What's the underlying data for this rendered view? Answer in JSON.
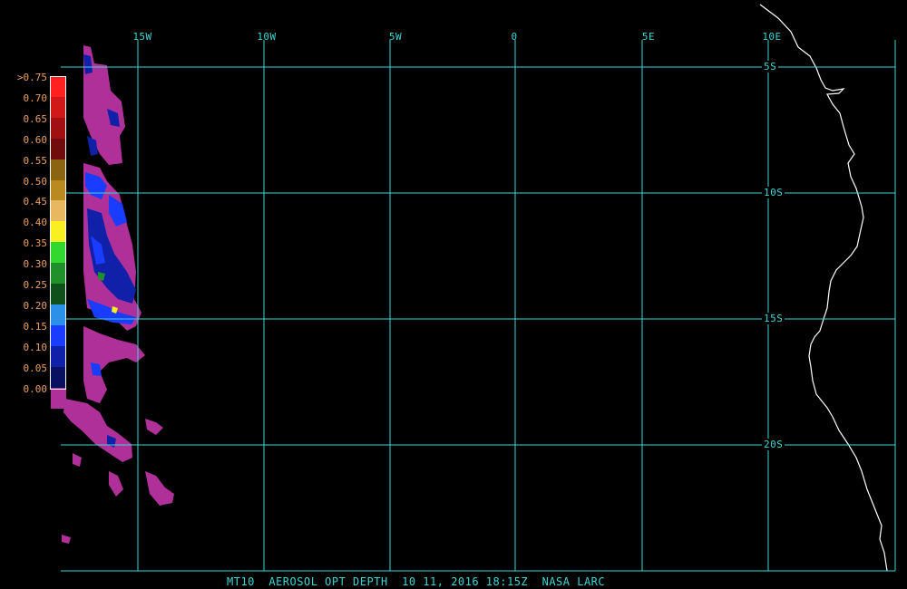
{
  "map": {
    "longitude_labels": [
      "15W",
      "10W",
      "5W",
      "0",
      "5E",
      "10E"
    ],
    "latitude_labels": [
      "5S",
      "10S",
      "15S",
      "20S"
    ],
    "colors": {
      "background": "#000000",
      "grid": "#3cd6d6",
      "coastline": "#ffffff",
      "legend_text": "#e8a060"
    }
  },
  "legend": {
    "items": [
      {
        "label": ">0.75",
        "color": "#ff2020"
      },
      {
        "label": "0.70",
        "color": "#d01818"
      },
      {
        "label": "0.65",
        "color": "#a01010"
      },
      {
        "label": "0.60",
        "color": "#700c0c"
      },
      {
        "label": "0.55",
        "color": "#8a6410"
      },
      {
        "label": "0.50",
        "color": "#b88a20"
      },
      {
        "label": "0.45",
        "color": "#e8b860"
      },
      {
        "label": "0.40",
        "color": "#f8f020"
      },
      {
        "label": "0.35",
        "color": "#30d830"
      },
      {
        "label": "0.30",
        "color": "#20902a"
      },
      {
        "label": "0.25",
        "color": "#10501a"
      },
      {
        "label": "0.20",
        "color": "#2a90e8"
      },
      {
        "label": "0.15",
        "color": "#1a3cff"
      },
      {
        "label": "0.10",
        "color": "#1020a8"
      },
      {
        "label": "0.05",
        "color": "#0a1060"
      },
      {
        "label": "0.00",
        "color": "#b0309a"
      }
    ]
  },
  "caption": "MT10  AEROSOL OPT DEPTH  10 11, 2016 18:15Z  NASA LARC"
}
